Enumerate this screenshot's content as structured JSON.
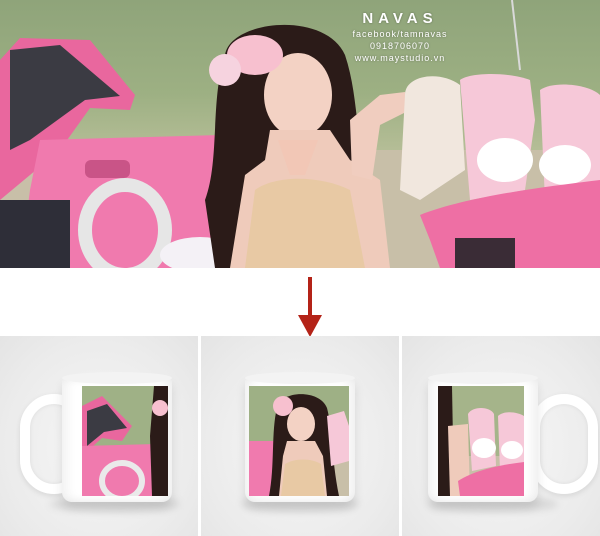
{
  "watermark": {
    "brand": "NAVAS",
    "facebook": "facebook/tamnavas",
    "phone": "0918706070",
    "website": "www.maystudio.vn"
  },
  "colors": {
    "arrow": "#b42318",
    "car_pink": "#ee6fa4",
    "seat_pink": "#f4c6d6",
    "grass": "#97aa7f"
  },
  "mockups": {
    "left_view": "handle-left",
    "center_view": "front",
    "right_view": "handle-right"
  }
}
